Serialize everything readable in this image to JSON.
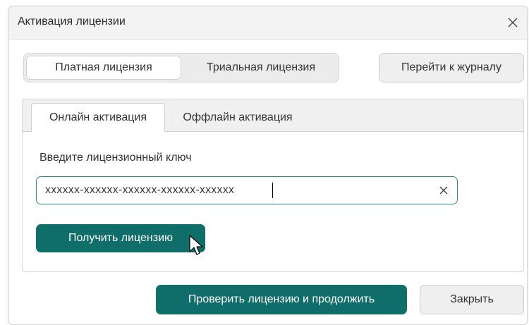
{
  "dialog": {
    "title": "Активация лицензии",
    "close_icon": "close-icon"
  },
  "license_type": {
    "options": [
      "Платная лицензия",
      "Триальная лицензия"
    ],
    "selected": "Платная лицензия"
  },
  "journal_button_label": "Перейти к журналу",
  "tabs": [
    {
      "label": "Онлайн активация",
      "active": true
    },
    {
      "label": "Оффлайн активация",
      "active": false
    }
  ],
  "online": {
    "field_label": "Введите лицензионный ключ",
    "key_value": "xxxxxx-xxxxxx-xxxxxx-xxxxxx-xxxxxx",
    "clear_icon": "clear-icon",
    "get_license_label": "Получить лицензию"
  },
  "footer": {
    "check_label": "Проверить лицензию и продолжить",
    "close_label": "Закрыть"
  },
  "colors": {
    "accent": "#0f6e6a",
    "input_border": "#2f8a86"
  }
}
